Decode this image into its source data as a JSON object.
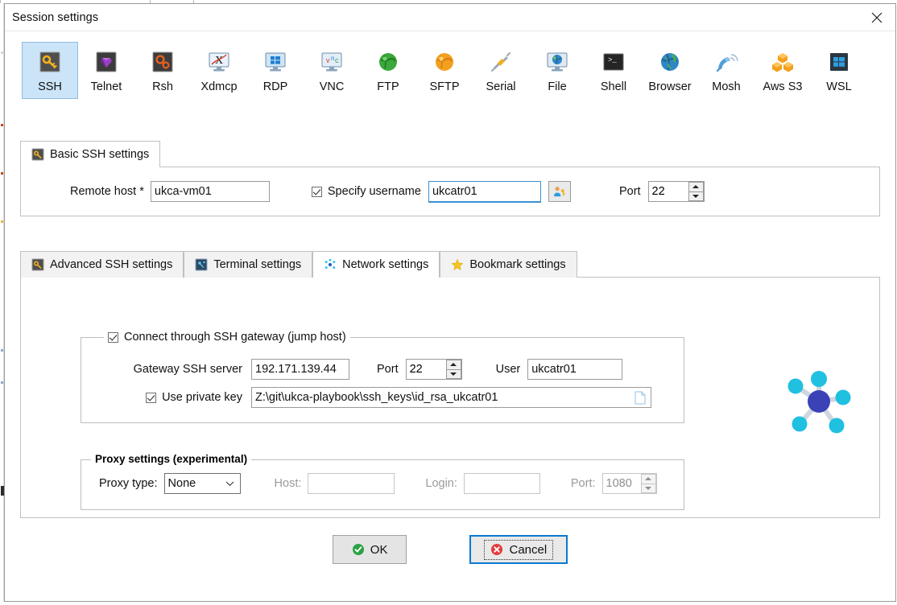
{
  "window": {
    "title": "Session settings",
    "close_icon": "close-icon"
  },
  "protocols": [
    {
      "label": "SSH",
      "icon": "ssh-key-icon",
      "selected": true
    },
    {
      "label": "Telnet",
      "icon": "telnet-icon",
      "selected": false
    },
    {
      "label": "Rsh",
      "icon": "rsh-gears-icon",
      "selected": false
    },
    {
      "label": "Xdmcp",
      "icon": "xdmcp-icon",
      "selected": false
    },
    {
      "label": "RDP",
      "icon": "rdp-windows-icon",
      "selected": false
    },
    {
      "label": "VNC",
      "icon": "vnc-icon",
      "selected": false
    },
    {
      "label": "FTP",
      "icon": "ftp-globe-icon",
      "selected": false
    },
    {
      "label": "SFTP",
      "icon": "sftp-globe-icon",
      "selected": false
    },
    {
      "label": "Serial",
      "icon": "serial-plug-icon",
      "selected": false
    },
    {
      "label": "File",
      "icon": "file-globe-icon",
      "selected": false
    },
    {
      "label": "Shell",
      "icon": "shell-prompt-icon",
      "selected": false
    },
    {
      "label": "Browser",
      "icon": "browser-globe-icon",
      "selected": false
    },
    {
      "label": "Mosh",
      "icon": "mosh-dish-icon",
      "selected": false
    },
    {
      "label": "Aws S3",
      "icon": "aws-s3-icon",
      "selected": false
    },
    {
      "label": "WSL",
      "icon": "wsl-windows-icon",
      "selected": false
    }
  ],
  "basic": {
    "tab_label": "Basic SSH settings",
    "tab_icon": "ssh-key-icon",
    "remote_host_label": "Remote host *",
    "remote_host_value": "ukca-vm01",
    "specify_username_label": "Specify username",
    "specify_username_checked": true,
    "username_value": "ukcatr01",
    "username_browse_icon": "user-key-icon",
    "port_label": "Port",
    "port_value": "22"
  },
  "lower_tabs": [
    {
      "label": "Advanced SSH settings",
      "icon": "ssh-key-icon",
      "active": false
    },
    {
      "label": "Terminal settings",
      "icon": "terminal-icon",
      "active": false
    },
    {
      "label": "Network settings",
      "icon": "network-dots-icon",
      "active": true
    },
    {
      "label": "Bookmark settings",
      "icon": "star-icon",
      "active": false
    }
  ],
  "gateway": {
    "group_label": "Connect through SSH gateway (jump host)",
    "group_checked": true,
    "server_label": "Gateway SSH server",
    "server_value": "192.171.139.44",
    "port_label": "Port",
    "port_value": "22",
    "user_label": "User",
    "user_value": "ukcatr01",
    "private_key_label": "Use private key",
    "private_key_checked": true,
    "private_key_value": "Z:\\git\\ukca-playbook\\ssh_keys\\id_rsa_ukcatr01",
    "private_key_browse_icon": "file-page-icon"
  },
  "proxy": {
    "group_label": "Proxy settings (experimental)",
    "type_label": "Proxy type:",
    "type_value": "None",
    "type_options": [
      "None"
    ],
    "host_label": "Host:",
    "host_value": "",
    "login_label": "Login:",
    "login_value": "",
    "port_label": "Port:",
    "port_value": "1080"
  },
  "decoration": {
    "graphic": "network-hub-graphic",
    "hub_color": "#3b42b5",
    "node_color": "#1fc0e0"
  },
  "footer": {
    "ok_label": "OK",
    "ok_icon": "check-circle-icon",
    "cancel_label": "Cancel",
    "cancel_icon": "error-circle-icon",
    "focused": "cancel"
  },
  "colors": {
    "selected_tab_bg": "#cce4f7",
    "focus_blue": "#0a79d0",
    "ok_green": "#29a345",
    "cancel_red": "#e33c3c"
  }
}
